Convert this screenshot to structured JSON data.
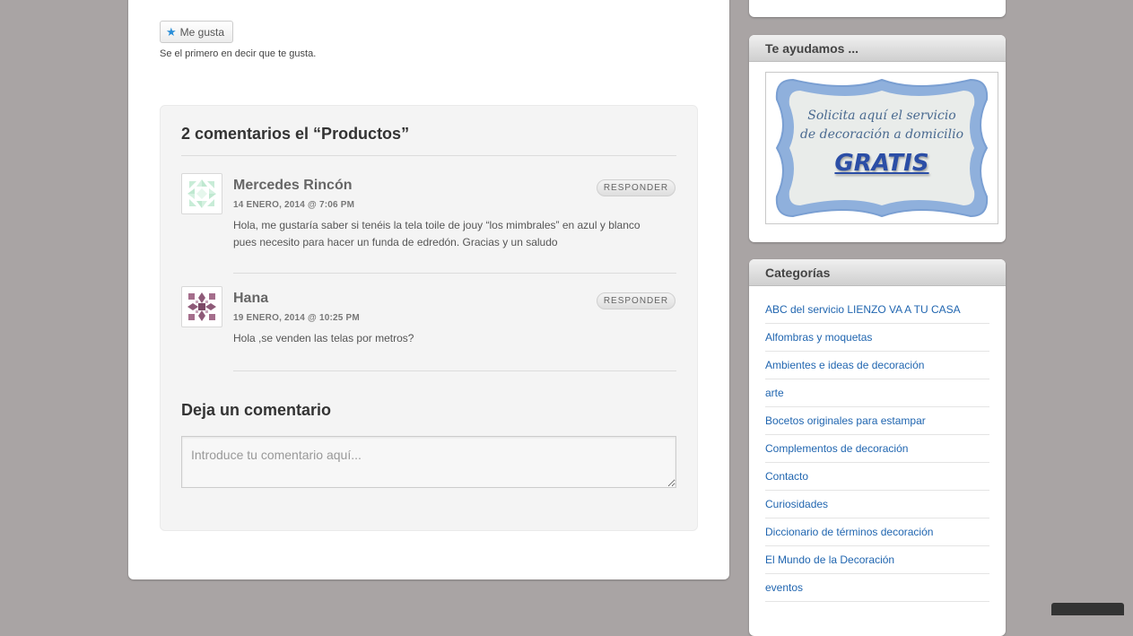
{
  "like": {
    "button_label": "Me gusta",
    "note": "Se el primero en decir que te gusta."
  },
  "comments": {
    "title": "2 comentarios el “Productos”",
    "reply_label": "RESPONDER",
    "items": [
      {
        "author": "Mercedes Rincón",
        "date": "14 ENERO, 2014 @ 7:06 PM",
        "text": "Hola, me gustaría saber si tenéis la tela toile de jouy “los mimbrales” en azul y blanco pues necesito para hacer un funda de edredón. Gracias y un saludo"
      },
      {
        "author": "Hana",
        "date": "19 ENERO, 2014 @ 10:25 PM",
        "text": "Hola ,se venden las telas por metros?"
      }
    ]
  },
  "leave_comment": {
    "title": "Deja un comentario",
    "placeholder": "Introduce tu comentario aquí..."
  },
  "sidebar": {
    "help_widget": {
      "title": "Te ayudamos ...",
      "promo_line1": "Solicita aquí el servicio",
      "promo_line2": "de decoración a domicilio",
      "promo_gratis": "GRATIS"
    },
    "categories_widget": {
      "title": "Categorías",
      "items": [
        "ABC del servicio LIENZO VA A TU CASA",
        "Alfombras y moquetas",
        "Ambientes e ideas de decoración",
        "arte",
        "Bocetos originales para estampar",
        "Complementos de decoración",
        "Contacto",
        "Curiosidades",
        "Diccionario de términos decoración",
        "El Mundo de la Decoración",
        "eventos"
      ]
    }
  },
  "colors": {
    "page_background": "#a9a4a4",
    "link": "#2166b0",
    "like_star": "#2a8ed8"
  }
}
